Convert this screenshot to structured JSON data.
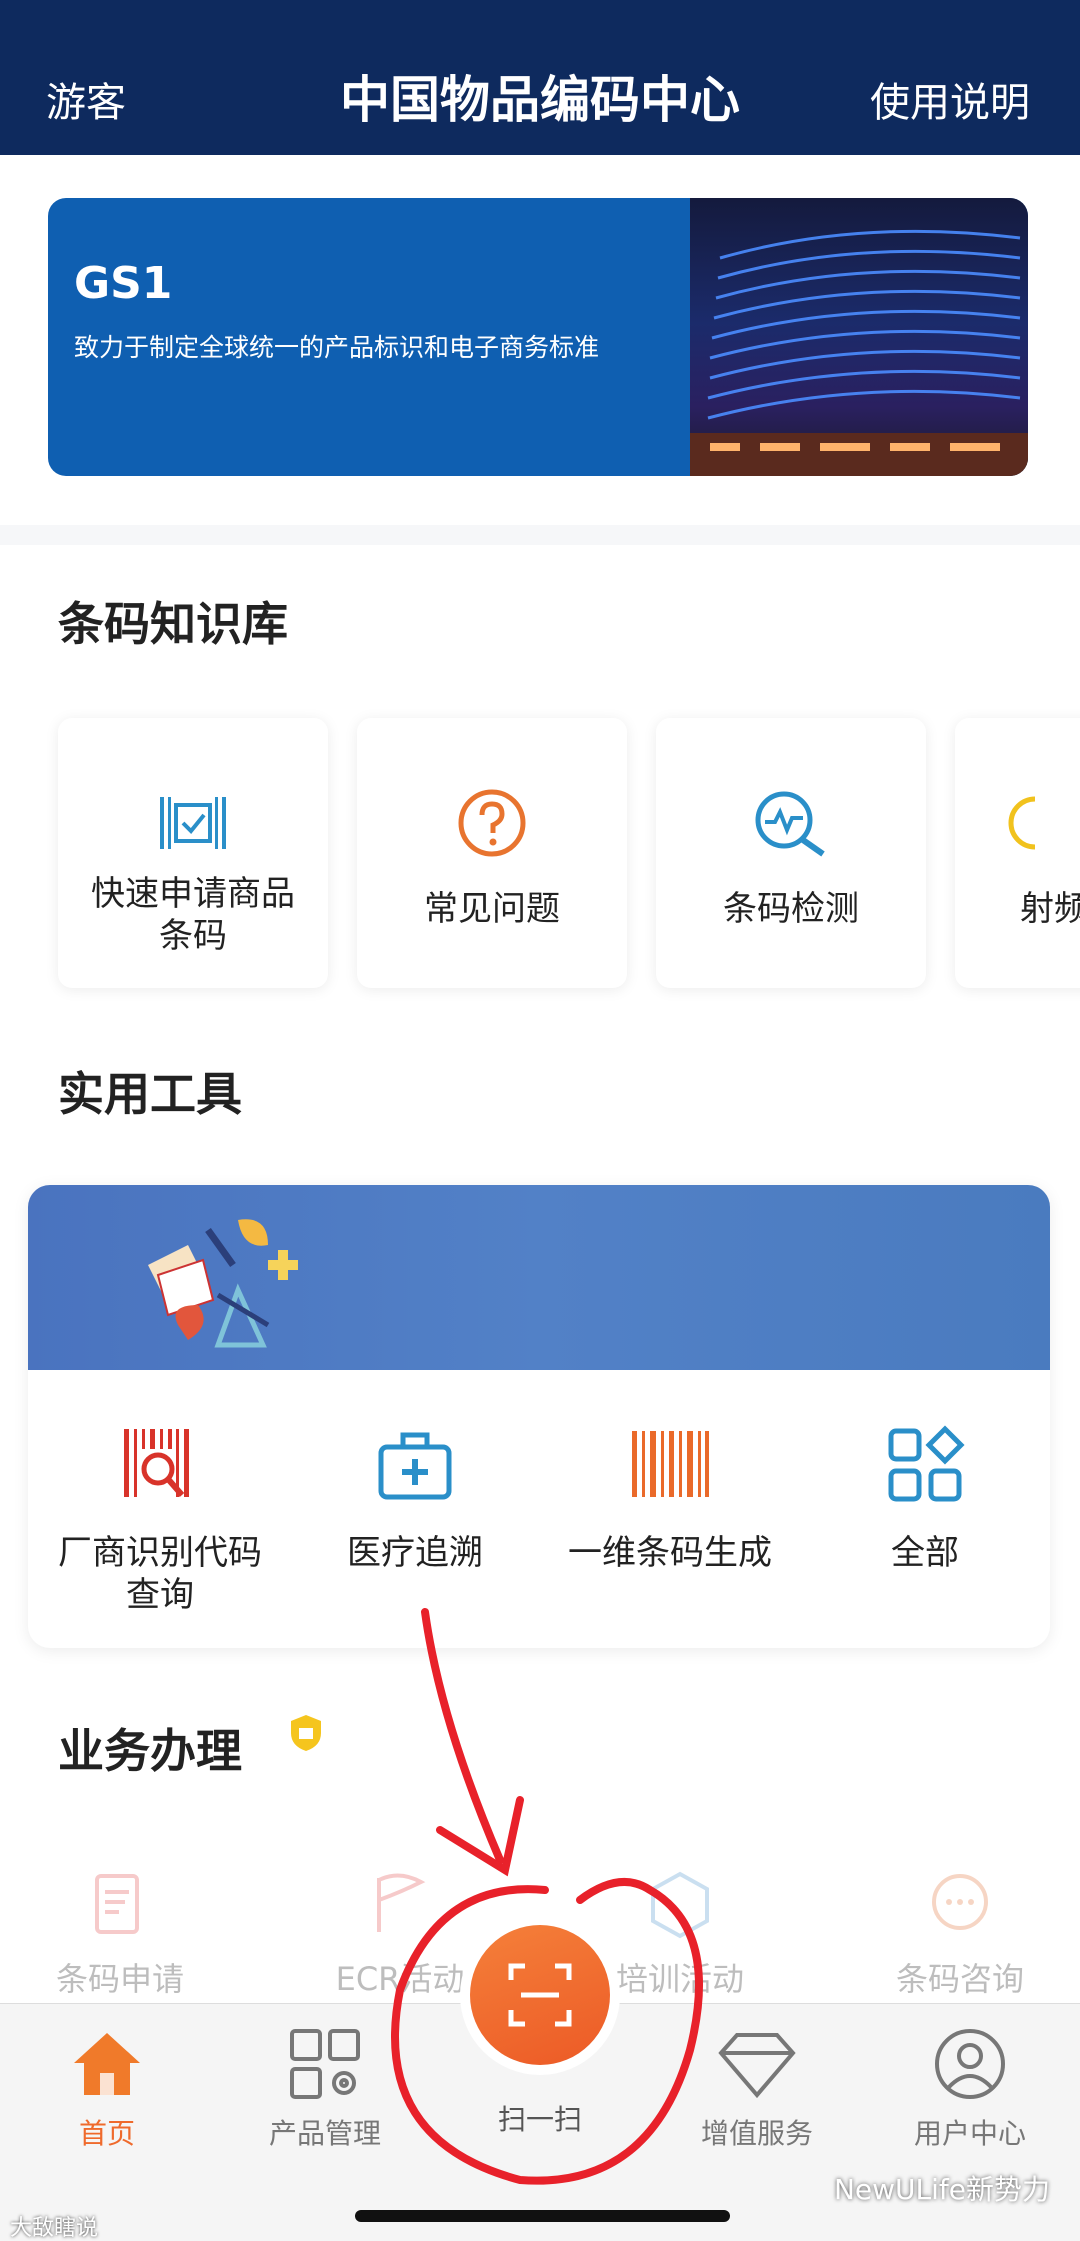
{
  "header": {
    "left": "游客",
    "title": "中国物品编码中心",
    "right": "使用说明"
  },
  "banner": {
    "brand": "GS1",
    "slogan": "致力于制定全球统一的产品标识和电子商务标准"
  },
  "knowledge": {
    "title": "条码知识库",
    "items": [
      {
        "label": "快速申请商品条码",
        "icon": "barcode-check-icon"
      },
      {
        "label": "常见问题",
        "icon": "question-icon"
      },
      {
        "label": "条码检测",
        "icon": "magnify-pulse-icon"
      },
      {
        "label": "射频",
        "icon": "rfid-icon"
      }
    ]
  },
  "tools": {
    "title": "实用工具",
    "items": [
      {
        "label": "厂商识别代码查询",
        "icon": "barcode-search-icon"
      },
      {
        "label": "医疗追溯",
        "icon": "medical-kit-icon"
      },
      {
        "label": "一维条码生成",
        "icon": "barcode-icon"
      },
      {
        "label": "全部",
        "icon": "grid-icon"
      }
    ]
  },
  "business": {
    "title": "业务办理",
    "items": [
      {
        "label": "条码申请"
      },
      {
        "label": "ECR活动"
      },
      {
        "label": "培训活动"
      },
      {
        "label": "条码咨询"
      }
    ]
  },
  "tabbar": {
    "items": [
      {
        "label": "首页",
        "active": true
      },
      {
        "label": "产品管理"
      },
      {
        "label": "扫一扫"
      },
      {
        "label": "增值服务"
      },
      {
        "label": "用户中心"
      }
    ]
  },
  "watermark": {
    "left": "大敌瞎说",
    "right": "NewULife新势力"
  },
  "colors": {
    "header": "#0e2a5e",
    "accent": "#ef6a2c",
    "banner": "#0f5fb1",
    "annotation": "#e8212a"
  }
}
